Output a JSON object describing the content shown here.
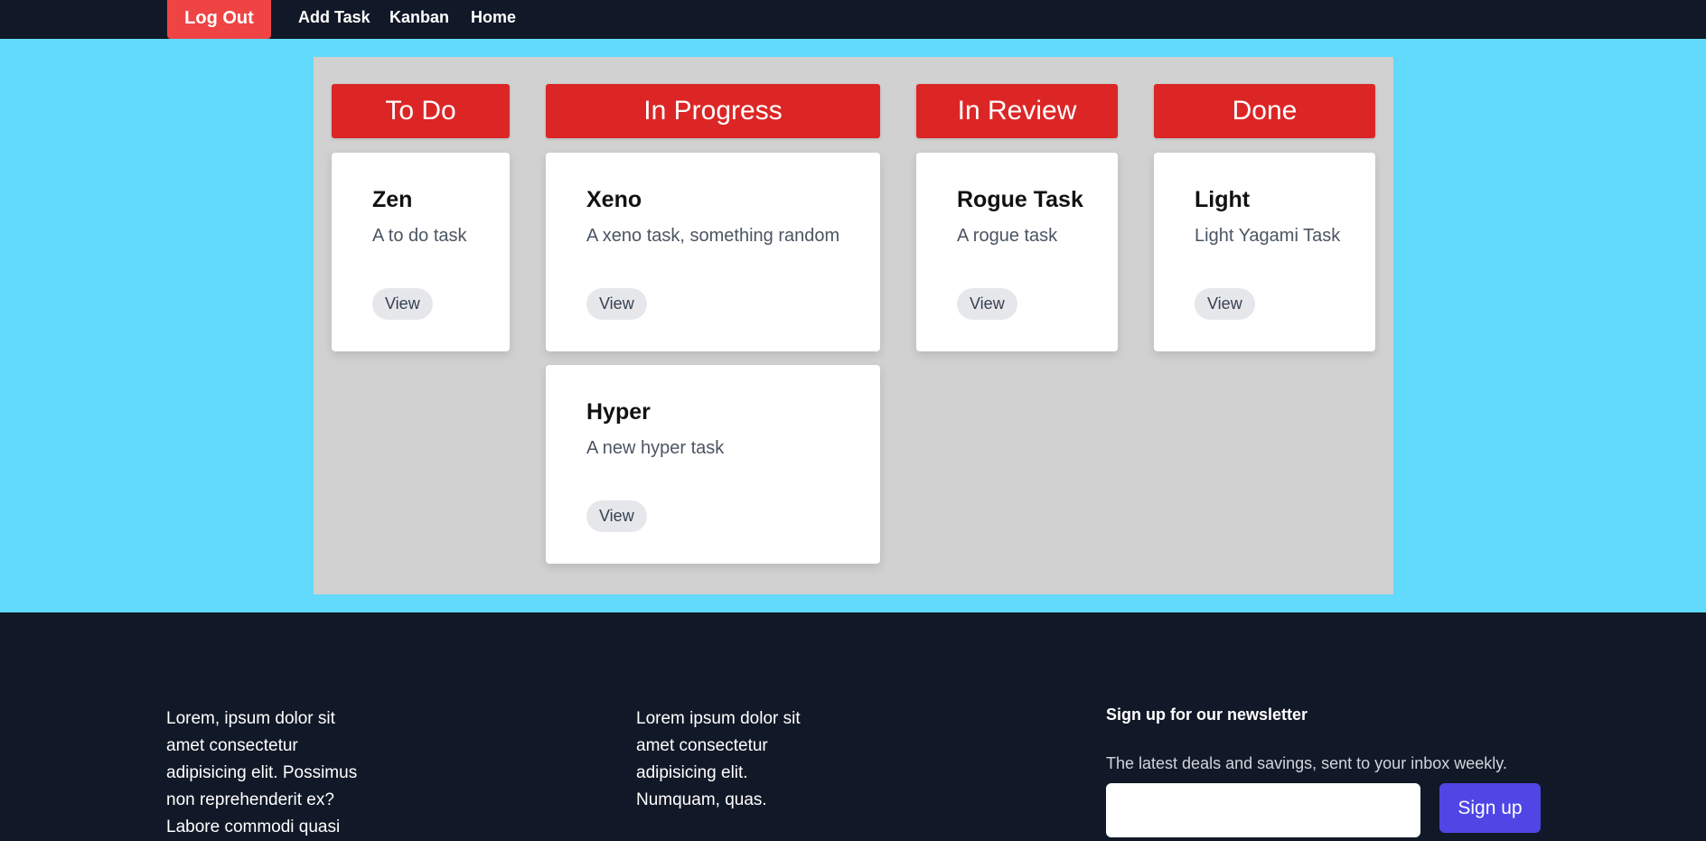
{
  "nav": {
    "logout_label": "Log Out",
    "links": [
      "Add Task",
      "Kanban",
      "Home"
    ]
  },
  "columns": [
    {
      "title": "To Do",
      "cards": [
        {
          "title": "Zen",
          "description": "A to do task",
          "button": "View"
        }
      ]
    },
    {
      "title": "In Progress",
      "cards": [
        {
          "title": "Xeno",
          "description": "A xeno task, something random",
          "button": "View"
        },
        {
          "title": "Hyper",
          "description": "A new hyper task",
          "button": "View"
        }
      ]
    },
    {
      "title": "In Review",
      "cards": [
        {
          "title": "Rogue Task",
          "description": "A rogue task",
          "button": "View"
        }
      ]
    },
    {
      "title": "Done",
      "cards": [
        {
          "title": "Light",
          "description": "Light Yagami Task",
          "button": "View"
        }
      ]
    }
  ],
  "footer": {
    "col1_lines": [
      "Lorem, ipsum dolor sit",
      "amet consectetur",
      "adipisicing elit. Possimus",
      "non reprehenderit ex?",
      "Labore commodi quasi"
    ],
    "col2_lines": [
      "Lorem ipsum dolor sit",
      "amet consectetur",
      "adipisicing elit.",
      "Numquam, quas."
    ],
    "newsletter_title": "Sign up for our newsletter",
    "newsletter_subtitle": "The latest deals and savings, sent to your inbox weekly.",
    "signup_label": "Sign up"
  },
  "colors": {
    "nav_bg": "#111827",
    "main_bg": "#61dafb",
    "board_bg": "#d1d1d1",
    "column_header": "#dc2626",
    "logout": "#ef4444",
    "signup": "#4f46e5"
  }
}
